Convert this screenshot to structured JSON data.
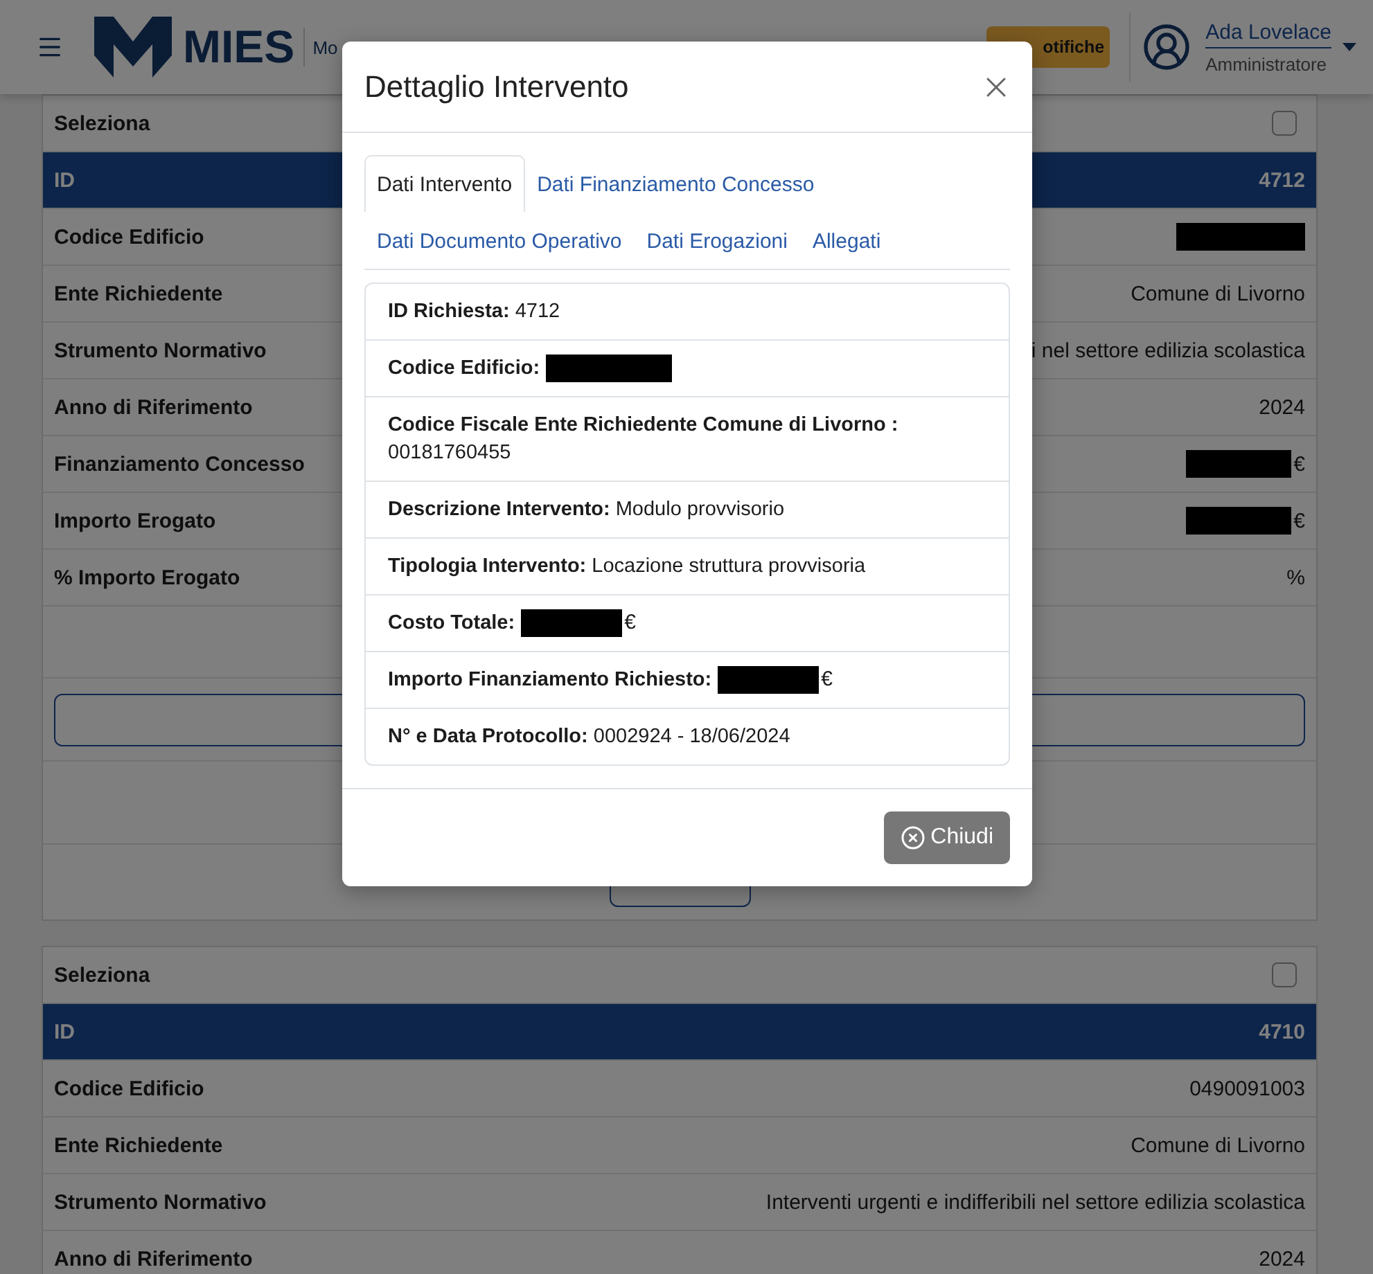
{
  "header": {
    "logo_text": "MIES",
    "subtitle": "Mo",
    "notifications_label": "otifiche",
    "user": {
      "name": "Ada Lovelace",
      "role": "Amministratore"
    }
  },
  "cards": [
    {
      "select_label": "Seleziona",
      "checked": false,
      "rows": [
        {
          "kind": "id",
          "label": "ID",
          "value": "4712"
        },
        {
          "kind": "redacted",
          "label": "Codice Edificio"
        },
        {
          "kind": "text",
          "label": "Ente Richiedente",
          "value": "Comune di Livorno"
        },
        {
          "kind": "text",
          "label": "Strumento Normativo",
          "value": "i nel settore edilizia scolastica"
        },
        {
          "kind": "text",
          "label": "Anno di Riferimento",
          "value": "2024"
        },
        {
          "kind": "redacted",
          "label": "Finanziamento Concesso",
          "suffix": "€"
        },
        {
          "kind": "redacted",
          "label": "Importo Erogato",
          "suffix": "€"
        },
        {
          "kind": "text",
          "label": "% Importo Erogato",
          "value": "%"
        }
      ],
      "actions": [
        {
          "kind": "spacer"
        },
        {
          "kind": "wide-button"
        },
        {
          "kind": "spacer"
        },
        {
          "kind": "small-button"
        }
      ]
    },
    {
      "select_label": "Seleziona",
      "checked": false,
      "rows": [
        {
          "kind": "id",
          "label": "ID",
          "value": "4710"
        },
        {
          "kind": "text",
          "label": "Codice Edificio",
          "value": "0490091003"
        },
        {
          "kind": "text",
          "label": "Ente Richiedente",
          "value": "Comune di Livorno"
        },
        {
          "kind": "text",
          "label": "Strumento Normativo",
          "value": "Interventi urgenti e indifferibili nel settore edilizia scolastica"
        },
        {
          "kind": "text",
          "label": "Anno di Riferimento",
          "value": "2024"
        }
      ]
    }
  ],
  "modal": {
    "title": "Dettaglio Intervento",
    "tabs": [
      {
        "label": "Dati Intervento",
        "selected": true
      },
      {
        "label": "Dati Finanziamento Concesso",
        "selected": false
      },
      {
        "label": "Dati Documento Operativo",
        "selected": false
      },
      {
        "label": "Dati Erogazioni",
        "selected": false
      },
      {
        "label": "Allegati",
        "selected": false
      }
    ],
    "fields": [
      {
        "label": "ID Richiesta:",
        "value": "4712"
      },
      {
        "label": "Codice Edificio:",
        "redacted": true
      },
      {
        "label": "Codice Fiscale Ente Richiedente Comune di Livorno :",
        "value": "00181760455"
      },
      {
        "label": "Descrizione Intervento:",
        "value": "Modulo provvisorio"
      },
      {
        "label": "Tipologia Intervento:",
        "value": "Locazione struttura provvisoria"
      },
      {
        "label": "Costo Totale:",
        "redacted": true,
        "suffix": "€"
      },
      {
        "label": "Importo Finanziamento Richiesto:",
        "redacted": true,
        "suffix": "€"
      },
      {
        "label": "N° e Data Protocollo:",
        "value": "0002924 - 18/06/2024"
      }
    ],
    "close_label": "Chiudi"
  }
}
